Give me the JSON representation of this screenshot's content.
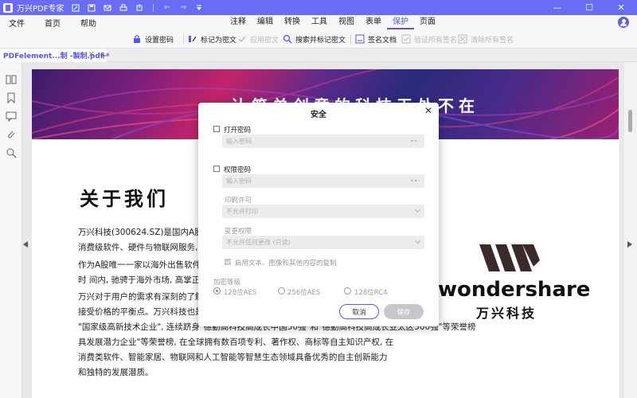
{
  "app": {
    "title": "万兴PDF专家"
  },
  "window_controls": {
    "minimize": "—",
    "maximize": "☐",
    "close": "✕"
  },
  "menu": {
    "left": [
      "文件",
      "首页",
      "帮助"
    ],
    "center": [
      "注释",
      "编辑",
      "转换",
      "工具",
      "视图",
      "表单",
      "保护",
      "页面"
    ],
    "active": "保护"
  },
  "ribbon": {
    "set_password": "设置密码",
    "mark_redaction": "标记为密文",
    "apply_redaction": "应用密文",
    "search_redact": "搜索并标记密文",
    "sign_document": "签名文档",
    "verify_signatures": "验证所有签名",
    "clear_signatures": "清除所有签名"
  },
  "tab": {
    "label": "PDFelement...制 -製制.pdf *",
    "close": "✕",
    "add": "+"
  },
  "document": {
    "banner_text": "让简单创意的科技无处不在",
    "heading": "关于我们",
    "paragraphs": [
      "万兴科技(300624.SZ)是国内A股上",
      "消费级软件、硬件与物联网服务, 致",
      "作为A股唯一一家以海外出售软件:",
      "时 间内, 驰骋于海外市场, 高掌正版",
      "万兴对于用户的需求有深刻的了解",
      "接受价格的平衡点。万兴科技也是中",
      "\"国家级高新技术企业\", 连续跻身\"德勤高科技高成长中国50强\"和\"德勤高科技高成长亚太区500强\"等荣誉榜",
      "具发展潜力企业\"等荣誉榜, 在全球拥有数百项专利、著作权、商标等自主知识产权, 在",
      "消费类软件、智能家居、物联网和人工智能等智慧生态领域具备优秀的自主创新能力",
      "和独特的发展潜质。"
    ],
    "logo_word": "wondershare",
    "logo_cn": "万兴科技"
  },
  "dialog": {
    "title": "安全",
    "open_password": {
      "label": "打开密码",
      "placeholder": "输入密码",
      "checked": false
    },
    "permission_password": {
      "label": "权限密码",
      "placeholder": "输入密码",
      "checked": false
    },
    "print_label": "印刷许可",
    "print_value": "不允许打印",
    "change_label": "变更权限",
    "change_value": "不允许任何更改 (只读)",
    "copy_label": "启用文本、图像和其他内容的复制",
    "encryption_label": "加密等级",
    "encryption_options": [
      "128位AES",
      "256位AES",
      "128位RC4"
    ],
    "encryption_selected": "128位AES",
    "cancel": "取消",
    "save": "保存"
  },
  "colors": {
    "accent": "#5458e8",
    "titlebar": "#6a6cf4"
  }
}
